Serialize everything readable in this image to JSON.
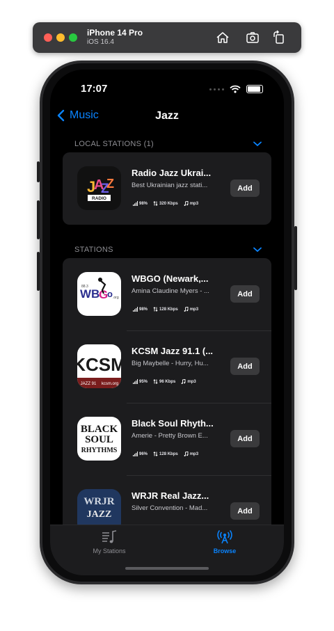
{
  "simulator": {
    "device_name": "iPhone 14 Pro",
    "os_version": "iOS 16.4",
    "icons": [
      "home-icon",
      "screenshot-icon",
      "rotate-icon"
    ]
  },
  "status_bar": {
    "time": "17:07"
  },
  "nav": {
    "back_label": "Music",
    "title": "Jazz"
  },
  "sections": {
    "local": {
      "header": "LOCAL STATIONS (1)"
    },
    "stations": {
      "header": "STATIONS"
    }
  },
  "local_stations": [
    {
      "name": "Radio Jazz Ukrai...",
      "subtitle": "Best Ukrainian jazz stati...",
      "signal": "98%",
      "bitrate": "320 Kbps",
      "format": "mp3",
      "action": "Add",
      "logo": "jazz-radio"
    }
  ],
  "stations": [
    {
      "name": "WBGO (Newark,...",
      "subtitle": "Amina Claudine Myers - ...",
      "signal": "98%",
      "bitrate": "128 Kbps",
      "format": "mp3",
      "action": "Add",
      "logo": "wbgo"
    },
    {
      "name": "KCSM Jazz 91.1 (...",
      "subtitle": "Big Maybelle - Hurry, Hu...",
      "signal": "95%",
      "bitrate": "96 Kbps",
      "format": "mp3",
      "action": "Add",
      "logo": "kcsm"
    },
    {
      "name": "Black Soul Rhyth...",
      "subtitle": "Amerie - Pretty Brown E...",
      "signal": "96%",
      "bitrate": "128 Kbps",
      "format": "mp3",
      "action": "Add",
      "logo": "black-soul"
    },
    {
      "name": "WRJR Real Jazz...",
      "subtitle": "Silver Convention - Mad...",
      "signal": "",
      "bitrate": "",
      "format": "",
      "action": "Add",
      "logo": "wrjr"
    }
  ],
  "tabbar": {
    "tabs": [
      {
        "label": "My Stations",
        "icon": "music-list-icon",
        "selected": false
      },
      {
        "label": "Browse",
        "icon": "broadcast-icon",
        "selected": true
      }
    ]
  },
  "colors": {
    "accent": "#0a84ff",
    "background": "#000000",
    "card": "#1c1c1e",
    "button": "#3a3a3c"
  }
}
